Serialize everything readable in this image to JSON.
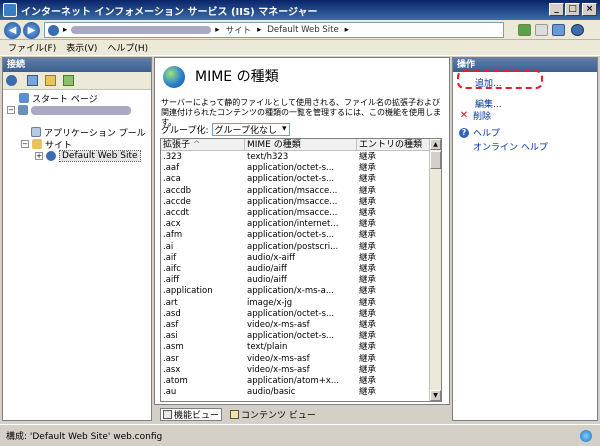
{
  "window": {
    "title": "インターネット インフォメーション サービス (IIS) マネージャー",
    "btn_min": "_",
    "btn_max": "□",
    "btn_close": "×"
  },
  "address": {
    "back": "◀",
    "forward": "▶",
    "segments": [
      "サイト",
      "Default Web Site"
    ],
    "sep": "▸"
  },
  "menu": [
    "ファイル(F)",
    "表示(V)",
    "ヘルプ(H)"
  ],
  "connections": {
    "title": "接続",
    "tree": [
      {
        "label": "スタート ページ"
      },
      {
        "label": ""
      },
      {
        "label": "アプリケーション プール"
      },
      {
        "label": "サイト"
      },
      {
        "label": "Default Web Site"
      }
    ],
    "expand_minus": "−",
    "expand_plus": "+"
  },
  "feature": {
    "title": "MIME の種類",
    "description": "サーバーによって静的ファイルとして使用される、ファイル名の拡張子および関連付けられたコンテンツの種類の一覧を管理するには、この機能を使用します。",
    "group_label": "グループ化:",
    "group_value": "グループ化なし",
    "dropdown_arrow": "▾"
  },
  "grid": {
    "columns": [
      "拡張子",
      "MIME の種類",
      "エントリの種類"
    ],
    "sort_indicator": "^",
    "scroll_up": "▲",
    "scroll_down": "▼",
    "rows": [
      [
        ".323",
        "text/h323",
        "継承"
      ],
      [
        ".aaf",
        "application/octet-s...",
        "継承"
      ],
      [
        ".aca",
        "application/octet-s...",
        "継承"
      ],
      [
        ".accdb",
        "application/msacce...",
        "継承"
      ],
      [
        ".accde",
        "application/msacce...",
        "継承"
      ],
      [
        ".accdt",
        "application/msacce...",
        "継承"
      ],
      [
        ".acx",
        "application/internet...",
        "継承"
      ],
      [
        ".afm",
        "application/octet-s...",
        "継承"
      ],
      [
        ".ai",
        "application/postscri...",
        "継承"
      ],
      [
        ".aif",
        "audio/x-aiff",
        "継承"
      ],
      [
        ".aifc",
        "audio/aiff",
        "継承"
      ],
      [
        ".aiff",
        "audio/aiff",
        "継承"
      ],
      [
        ".application",
        "application/x-ms-a...",
        "継承"
      ],
      [
        ".art",
        "image/x-jg",
        "継承"
      ],
      [
        ".asd",
        "application/octet-s...",
        "継承"
      ],
      [
        ".asf",
        "video/x-ms-asf",
        "継承"
      ],
      [
        ".asi",
        "application/octet-s...",
        "継承"
      ],
      [
        ".asm",
        "text/plain",
        "継承"
      ],
      [
        ".asr",
        "video/x-ms-asf",
        "継承"
      ],
      [
        ".asx",
        "video/x-ms-asf",
        "継承"
      ],
      [
        ".atom",
        "application/atom+x...",
        "継承"
      ],
      [
        ".au",
        "audio/basic",
        "継承"
      ]
    ]
  },
  "view_tabs": [
    "機能ビュー",
    "コンテンツ ビュー"
  ],
  "actions": {
    "title": "操作",
    "add": "追加...",
    "edit": "編集...",
    "delete": "削除",
    "help": "ヘルプ",
    "online_help": "オンライン ヘルプ",
    "delete_icon": "✕",
    "help_icon": "?"
  },
  "status": {
    "text": "構成: 'Default Web Site' web.config"
  },
  "colors": {
    "title_bar": "#0a246a",
    "panel_header": "#4a6c99",
    "link": "#0033a0",
    "highlight_box": "#e0202a"
  }
}
